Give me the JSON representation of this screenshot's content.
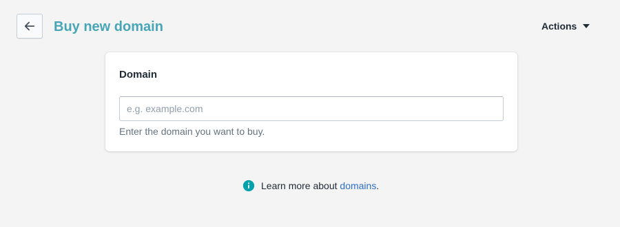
{
  "header": {
    "back_icon": "arrow-left-icon",
    "title": "Buy new domain",
    "actions_label": "Actions",
    "actions_icon": "caret-down-icon"
  },
  "card": {
    "title": "Domain",
    "input_placeholder": "e.g. example.com",
    "input_value": "",
    "help_text": "Enter the domain you want to buy."
  },
  "footer": {
    "info_icon": "info-icon",
    "text": "Learn more about ",
    "link_label": "domains",
    "suffix": "."
  },
  "colors": {
    "background": "#f4f4f4",
    "title": "#47a6b5",
    "info_icon": "#00a0ac",
    "link": "#2c6ecb"
  }
}
